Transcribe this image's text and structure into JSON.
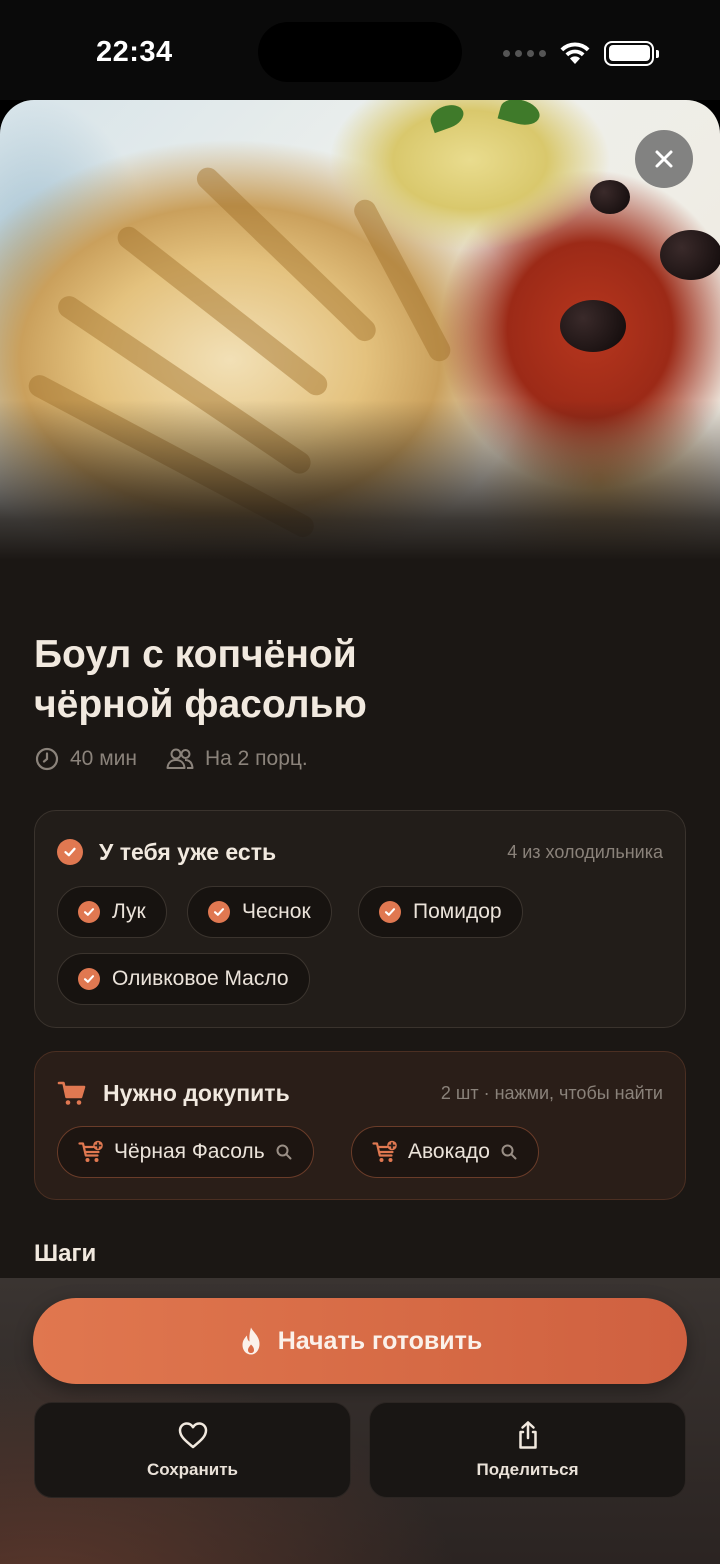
{
  "status_bar": {
    "time": "22:34"
  },
  "recipe": {
    "title_line1": "Боул с копчёной",
    "title_line2": "чёрной фасолью",
    "time": "40 мин",
    "servings": "На 2 порц."
  },
  "have_card": {
    "title": "У тебя уже есть",
    "note": "4 из холодильника",
    "items": [
      "Лук",
      "Чеснок",
      "Помидор",
      "Оливковое Масло"
    ]
  },
  "buy_card": {
    "title": "Нужно докупить",
    "note": "2 шт · нажми, чтобы найти",
    "items": [
      "Чёрная Фасоль",
      "Авокадо"
    ]
  },
  "steps_label": "Шаги",
  "actions": {
    "start": "Начать готовить",
    "save": "Сохранить",
    "share": "Поделиться"
  },
  "colors": {
    "accent": "#e07851",
    "background": "#1b1714",
    "card_have": "#221d19",
    "card_buy": "#2a1e18"
  },
  "icons": {
    "close": "close-icon",
    "clock": "clock-icon",
    "people": "people-icon",
    "check": "check-icon",
    "cart": "cart-icon",
    "cart_plus": "cart-plus-icon",
    "search": "search-icon",
    "flame": "flame-icon",
    "heart": "heart-icon",
    "share": "share-icon"
  }
}
